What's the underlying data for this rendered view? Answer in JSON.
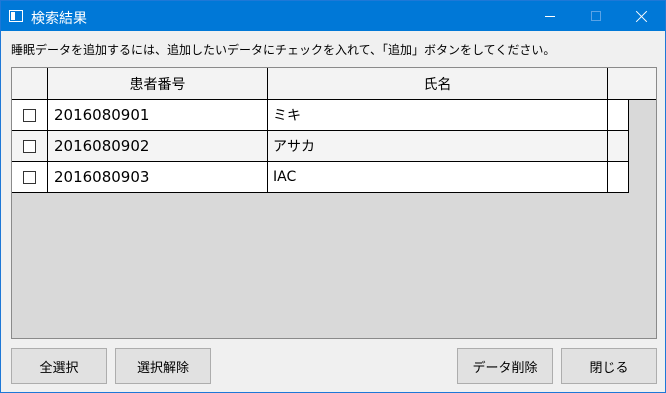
{
  "window": {
    "title": "検索結果"
  },
  "instruction": "睡眠データを追加するには、追加したいデータにチェックを入れて、「追加」ボタンをしてください。",
  "table": {
    "columns": [
      "",
      "患者番号",
      "氏名",
      ""
    ],
    "rows": [
      {
        "checked": false,
        "patient_id": "2016080901",
        "name": "ミキ"
      },
      {
        "checked": false,
        "patient_id": "2016080902",
        "name": "アサカ"
      },
      {
        "checked": false,
        "patient_id": "2016080903",
        "name": "IAC"
      }
    ]
  },
  "buttons": {
    "select_all": "全選択",
    "deselect": "選択解除",
    "delete_data": "データ削除",
    "close": "閉じる"
  },
  "colors": {
    "titlebar": "#0078d7",
    "window_bg": "#f0f0f0",
    "grid_bg": "#d9d9d9"
  }
}
